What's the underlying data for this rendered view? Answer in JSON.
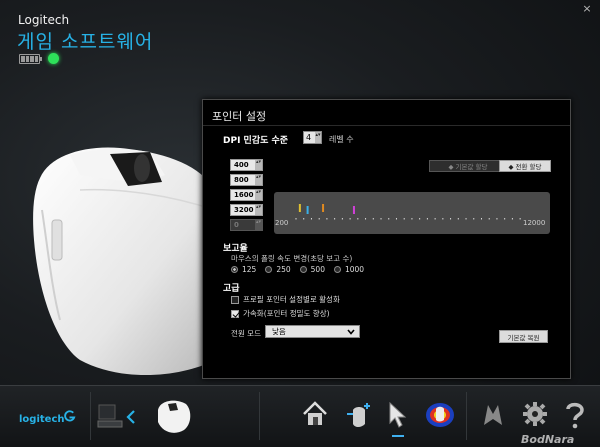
{
  "window": {
    "close_glyph": "×"
  },
  "header": {
    "brand": "Logitech",
    "title": "게임 소프트웨어",
    "status_color": "#2ee05a"
  },
  "panel": {
    "title": "포인터 설정",
    "dpi_label": "DPI 민감도 수준",
    "dpi_level_count": "4",
    "level_unit": "레벨 수",
    "dpi_levels": [
      "400",
      "800",
      "1600",
      "3200",
      "0"
    ],
    "btn_default_shift": "◆ 기본값 할당",
    "btn_shift": "◆ 전환 할당",
    "slider": {
      "min": "200",
      "max": "12000",
      "markers": [
        {
          "dpi": 400,
          "color": "#e0c030"
        },
        {
          "dpi": 800,
          "color": "#3ab0e8"
        },
        {
          "dpi": 1600,
          "color": "#e08a20"
        },
        {
          "dpi": 3200,
          "color": "#d040d8"
        }
      ]
    },
    "report_heading": "보고율",
    "report_desc": "마우스의 폴링 속도 변경(초당 보고 수)",
    "report_rates": [
      "125",
      "250",
      "500",
      "1000"
    ],
    "report_selected": "125",
    "advanced_heading": "고급",
    "chk_pointer_settings": "프로필 포인터 설정별로 활성화",
    "chk_acceleration": "가속화(포인터 정밀도 향상)",
    "power_mode_label": "전원 모드",
    "power_mode_value": "낮음",
    "btn_reset": "기본값 복원"
  },
  "taskbar": {
    "logo_text": "logitech",
    "watermark": "BodNara",
    "accent": "#27b2e6"
  }
}
